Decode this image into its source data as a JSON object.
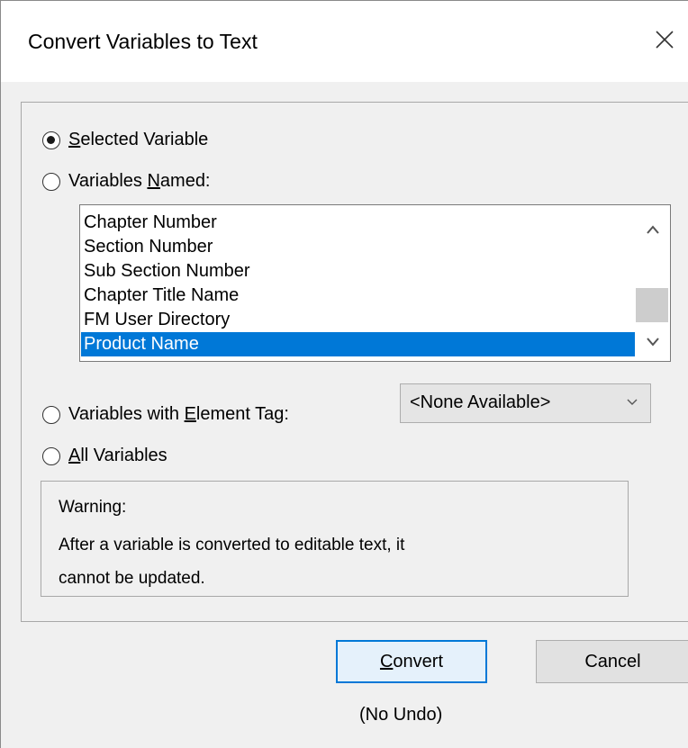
{
  "dialog": {
    "title": "Convert Variables to Text",
    "close_icon": "close-icon"
  },
  "options": {
    "selected_variable": {
      "before": "",
      "mnemonic": "S",
      "after": "elected Variable",
      "checked": true
    },
    "variables_named": {
      "before": "Variables ",
      "mnemonic": "N",
      "after": "amed:",
      "checked": false
    },
    "variables_with_tag": {
      "before": "Variables with ",
      "mnemonic": "E",
      "after": "lement Tag:",
      "checked": false
    },
    "all_variables": {
      "before": "",
      "mnemonic": "A",
      "after": "ll Variables",
      "checked": false
    }
  },
  "variable_list": {
    "items": [
      "Chapter Number",
      "Section Number",
      "Sub Section Number",
      "Chapter Title Name",
      "FM User Directory",
      "Product Name"
    ],
    "selected": "Product Name",
    "icons": {
      "up": "chevron-up-icon",
      "down": "chevron-down-icon"
    }
  },
  "element_tag_select": {
    "value": "<None Available>",
    "icon": "chevron-down-icon"
  },
  "warning": {
    "title": "Warning:",
    "line1": "After a variable is converted to editable text, it",
    "line2": "cannot be updated."
  },
  "buttons": {
    "convert": {
      "mnemonic": "C",
      "after": "onvert"
    },
    "cancel": "Cancel"
  },
  "footer_note": "(No Undo)",
  "colors": {
    "selection": "#0078d7",
    "dialog_bg": "#f0f0f0",
    "default_button_border": "#0078d7"
  }
}
